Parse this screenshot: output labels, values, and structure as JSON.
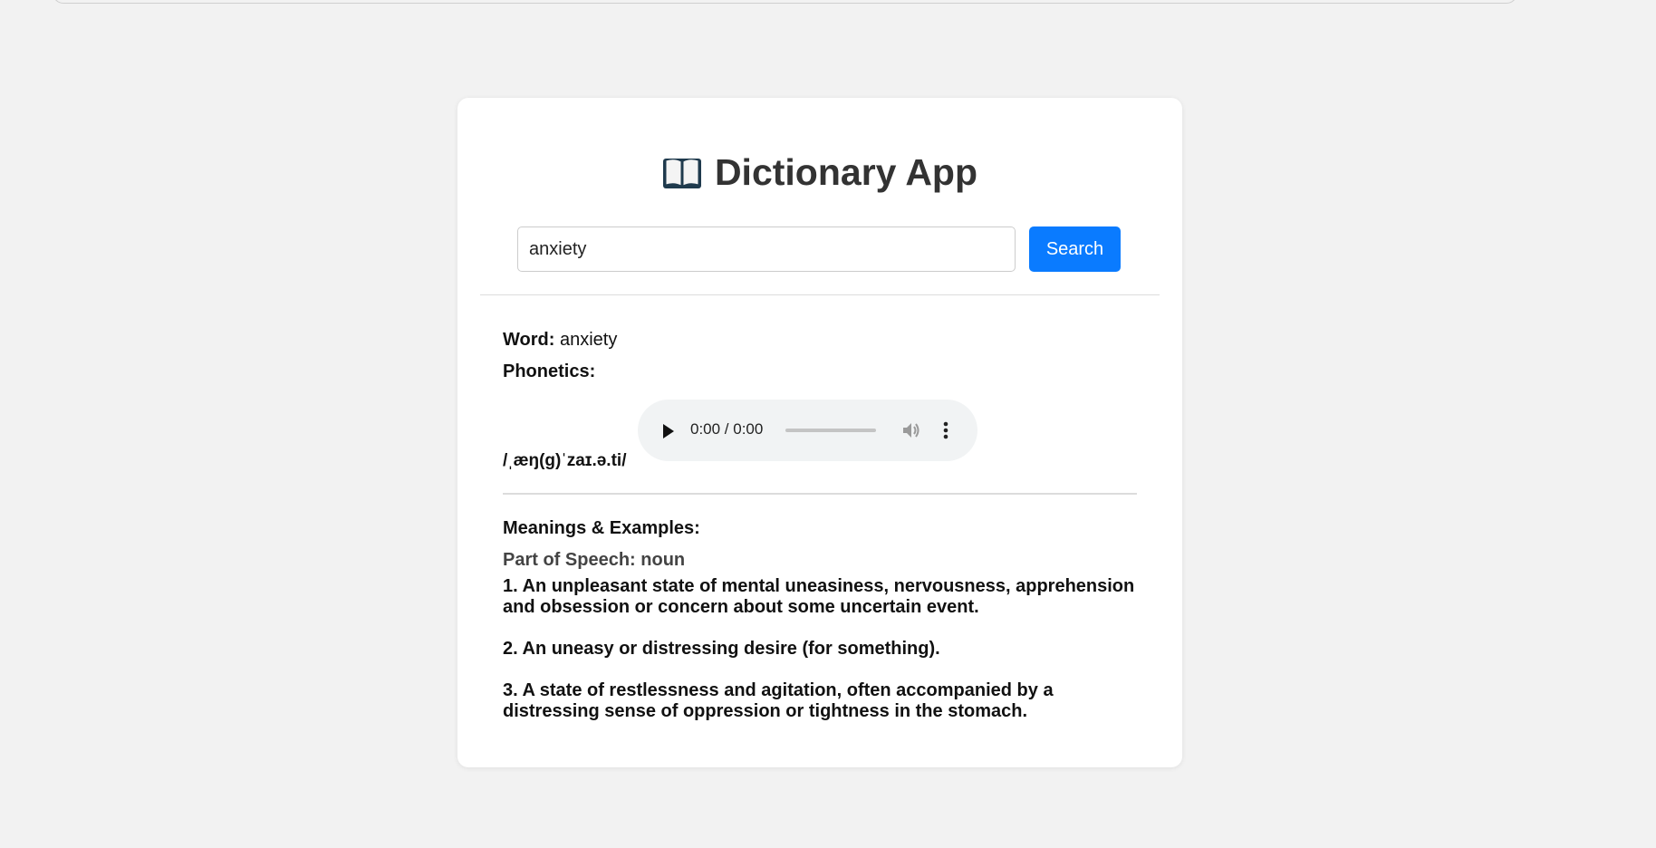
{
  "app": {
    "title": "Dictionary App",
    "title_icon": "open-book-icon"
  },
  "search": {
    "value": "anxiety",
    "button_label": "Search"
  },
  "result": {
    "word_label": "Word:",
    "word": "anxiety",
    "phonetics_label": "Phonetics:",
    "phonetic_text": "/ˌæŋ(ɡ)ˈzaɪ.ə.ti/",
    "audio": {
      "time": "0:00 / 0:00",
      "play_icon": "play-icon",
      "volume_icon": "volume-icon",
      "more_icon": "more-vertical-icon"
    },
    "meanings_heading": "Meanings & Examples:",
    "part_of_speech": "Part of Speech: noun",
    "definitions": [
      "1. An unpleasant state of mental uneasiness, nervousness, apprehension and obsession or concern about some uncertain event.",
      "2. An uneasy or distressing desire (for something).",
      "3. A state of restlessness and agitation, often accompanied by a distressing sense of oppression or tightness in the stomach."
    ]
  },
  "colors": {
    "page_background": "#f2f2f2",
    "card_background": "#ffffff",
    "accent": "#0a7bff",
    "title_text": "#333333",
    "audio_player_background": "#f1f3f4"
  }
}
